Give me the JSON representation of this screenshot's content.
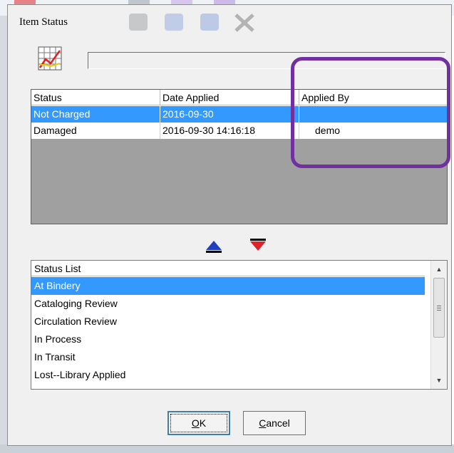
{
  "window": {
    "title": "Item Status"
  },
  "header_field": {
    "value": ""
  },
  "status_table": {
    "columns": [
      "Status",
      "Date Applied",
      "Applied By"
    ],
    "rows": [
      {
        "status": "Not Charged",
        "date_applied": "2016-09-30",
        "applied_by": "",
        "selected": true
      },
      {
        "status": "Damaged",
        "date_applied": "2016-09-30 14:16:18",
        "applied_by": "demo",
        "selected": false
      }
    ]
  },
  "move_buttons": {
    "up_icon": "triangle-up-blue",
    "down_icon": "triangle-down-red"
  },
  "status_list": {
    "header": "Status List",
    "items": [
      "At Bindery",
      "Cataloging Review",
      "Circulation Review",
      "In Process",
      "In Transit",
      "Lost--Library Applied"
    ],
    "selected_index": 0
  },
  "buttons": {
    "ok": {
      "accel": "O",
      "rest": "K"
    },
    "cancel": {
      "accel": "C",
      "rest": "ancel"
    }
  },
  "colors": {
    "selection": "#3399ff",
    "highlight_annotation": "#7030a0",
    "up_arrow": "#1f3fbf",
    "down_arrow": "#e0202a"
  }
}
